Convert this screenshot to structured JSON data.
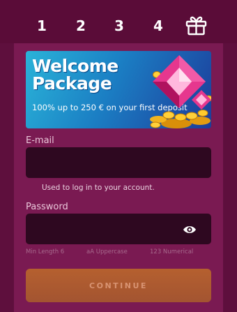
{
  "steps": [
    "1",
    "2",
    "3",
    "4"
  ],
  "banner": {
    "title_line1": "Welcome",
    "title_line2": "Package",
    "subtitle": "100% up to 250 € on your first deposit"
  },
  "form": {
    "email_label": "E-mail",
    "email_value": "",
    "email_hint": "Used to log in to your account.",
    "password_label": "Password",
    "password_value": "",
    "requirements": [
      "Min Length 6",
      "aA Uppercase",
      "123 Numerical"
    ],
    "continue_label": "CONTINUE"
  },
  "icons": {
    "gift": "gift-icon",
    "eye": "eye-icon",
    "gem": "gem-icon",
    "coins": "coins-icon"
  },
  "colors": {
    "background": "#5e0f3d",
    "panel": "#7a1a52",
    "input": "#2e0820",
    "button": "#b05a30",
    "banner_gradient_start": "#2ab3d8",
    "banner_gradient_end": "#1d3c9a"
  }
}
